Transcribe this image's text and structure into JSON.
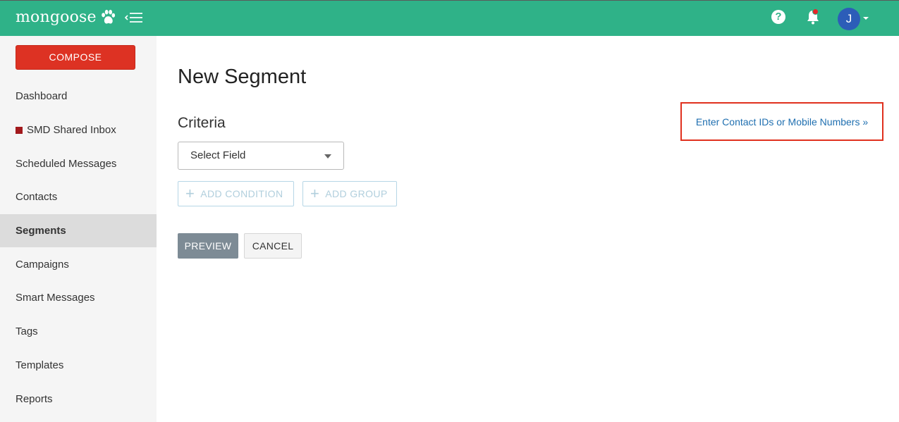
{
  "header": {
    "logo_text": "mongoose",
    "brand_color": "#2fb288",
    "avatar_initial": "J"
  },
  "sidebar": {
    "compose_label": "COMPOSE",
    "items": [
      {
        "label": "Dashboard"
      },
      {
        "label": "SMD Shared Inbox"
      },
      {
        "label": "Scheduled Messages"
      },
      {
        "label": "Contacts"
      },
      {
        "label": "Segments"
      },
      {
        "label": "Campaigns"
      },
      {
        "label": "Smart Messages"
      },
      {
        "label": "Tags"
      },
      {
        "label": "Templates"
      },
      {
        "label": "Reports"
      }
    ],
    "active_item": "Segments"
  },
  "main": {
    "title": "New Segment",
    "criteria_label": "Criteria",
    "select_field_value": "Select Field",
    "add_condition_label": "ADD CONDITION",
    "add_group_label": "ADD GROUP",
    "preview_label": "PREVIEW",
    "cancel_label": "CANCEL",
    "contact_link": "Enter Contact IDs or Mobile Numbers »"
  },
  "icons": {
    "logo": "paw-icon",
    "menu_toggle": "menu-collapse-icon",
    "help": "help-icon",
    "notifications": "bell-icon",
    "avatar_menu": "chevron-down-icon"
  }
}
